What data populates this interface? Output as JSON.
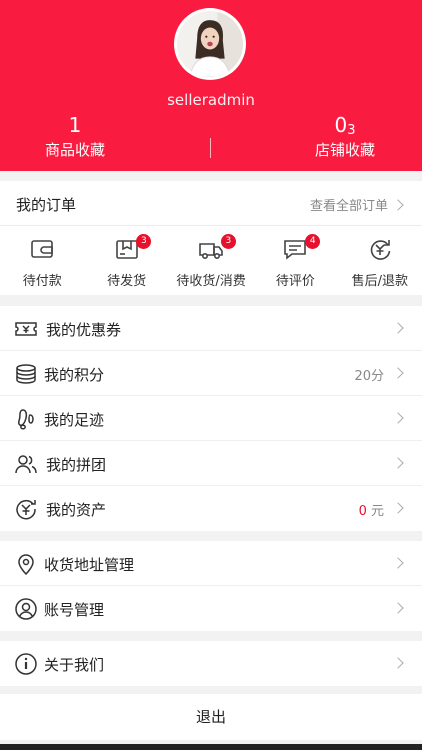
{
  "header": {
    "username": "selleradmin",
    "favorites_goods": {
      "count": "1",
      "label": "商品收藏"
    },
    "favorites_store": {
      "count": "0",
      "count_sub": "3",
      "label": "店铺收藏"
    }
  },
  "orders": {
    "title": "我的订单",
    "view_all": "查看全部订单",
    "items": [
      {
        "label": "待付款",
        "icon": "wallet-icon",
        "badge": ""
      },
      {
        "label": "待发货",
        "icon": "package-icon",
        "badge": "3"
      },
      {
        "label": "待收货/消费",
        "icon": "truck-icon",
        "badge": "3"
      },
      {
        "label": "待评价",
        "icon": "comment-icon",
        "badge": "4"
      },
      {
        "label": "售后/退款",
        "icon": "refund-icon",
        "badge": ""
      }
    ]
  },
  "menu1": [
    {
      "label": "我的优惠券",
      "icon": "coupon-icon",
      "value": ""
    },
    {
      "label": "我的积分",
      "icon": "coins-icon",
      "value": "20分"
    },
    {
      "label": "我的足迹",
      "icon": "footprint-icon",
      "value": ""
    },
    {
      "label": "我的拼团",
      "icon": "group-icon",
      "value": ""
    },
    {
      "label": "我的资产",
      "icon": "asset-icon",
      "value_num": "0",
      "value_unit": "元"
    }
  ],
  "menu2": [
    {
      "label": "收货地址管理",
      "icon": "location-icon"
    },
    {
      "label": "账号管理",
      "icon": "user-icon"
    }
  ],
  "menu3": [
    {
      "label": "关于我们",
      "icon": "info-icon"
    }
  ],
  "logout": "退出",
  "colors": {
    "brand": "#fa1c40",
    "badge": "#e8112d"
  }
}
